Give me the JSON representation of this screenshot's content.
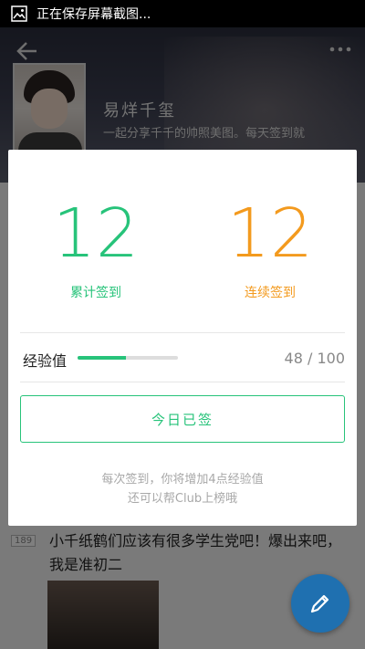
{
  "status_bar": {
    "text": "正在保存屏幕截图..."
  },
  "club": {
    "name": "易烊千玺",
    "description": "一起分享千千的帅照美图。每天签到就"
  },
  "dialog": {
    "total": {
      "value": "12",
      "label": "累计签到"
    },
    "streak": {
      "value": "12",
      "label": "连续签到"
    },
    "experience": {
      "label": "经验值",
      "current": 48,
      "max": 100,
      "display": "48 / 100"
    },
    "sign_button": "今日已签",
    "hint_line1": "每次签到，你将增加4点经验值",
    "hint_line2": "还可以帮Club上榜哦"
  },
  "post": {
    "count": "189",
    "text": "小千纸鹤们应该有很多学生党吧！爆出来吧，我是准初二"
  },
  "colors": {
    "green": "#27c37a",
    "orange": "#f39a1e",
    "fab": "#1f70b0"
  },
  "icons": [
    "image-icon",
    "back-arrow-icon",
    "more-icon",
    "pencil-icon"
  ]
}
